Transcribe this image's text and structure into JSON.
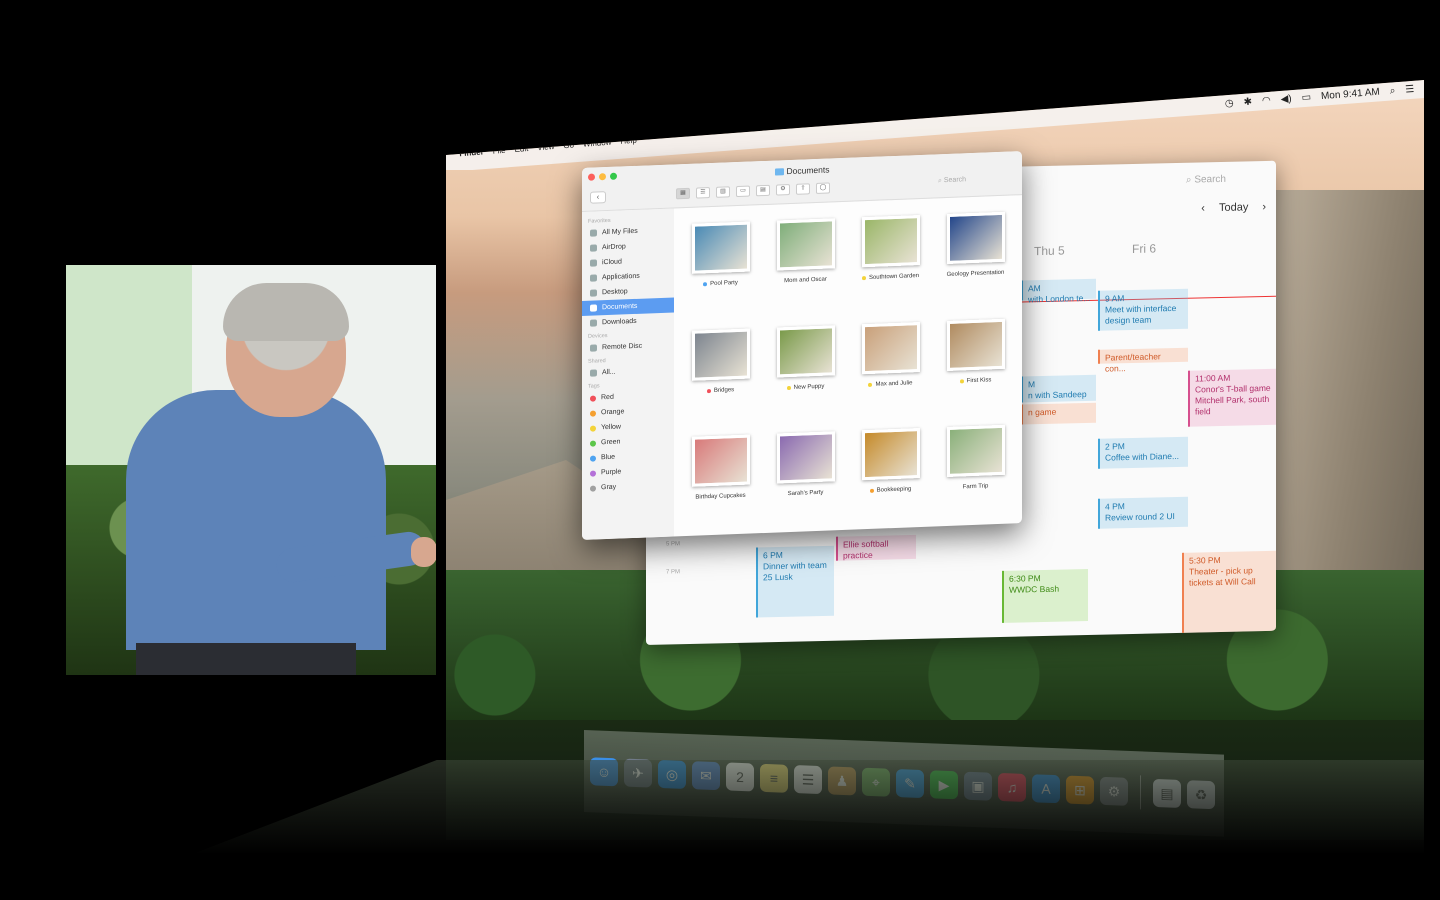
{
  "menubar": {
    "apple": "",
    "app_name": "Finder",
    "menus": [
      "File",
      "Edit",
      "View",
      "Go",
      "Window",
      "Help"
    ],
    "clock": "Mon 9:41 AM"
  },
  "calendar": {
    "search_placeholder": "Search",
    "today_label": "Today",
    "days": [
      "Thu 5",
      "Fri 6"
    ],
    "times": [
      "5 PM",
      "7 PM"
    ],
    "events": [
      {
        "text": "AM\nwith London te...",
        "color": "blue"
      },
      {
        "text": "9 AM\nMeet with interface design team",
        "color": "blue"
      },
      {
        "text": "Parent/teacher con...",
        "color": "orange"
      },
      {
        "text": "11:00 AM\nConor's T-ball game Mitchell Park, south field",
        "color": "pink"
      },
      {
        "text": "M\nn with Sandeep",
        "color": "blue"
      },
      {
        "text": "n game",
        "color": "orange"
      },
      {
        "text": "2 PM\nCoffee with Diane...",
        "color": "blue"
      },
      {
        "text": "4 PM\nReview round 2 UI",
        "color": "blue"
      },
      {
        "text": "Ellie softball practice",
        "color": "pink"
      },
      {
        "text": "6 PM\nDinner with team 25 Lusk",
        "color": "blue"
      },
      {
        "text": "6:30 PM\nWWDC Bash",
        "color": "green"
      },
      {
        "text": "5:30 PM\nTheater - pick up tickets at Will Call",
        "color": "orange"
      }
    ]
  },
  "finder": {
    "title": "Documents",
    "search_placeholder": "Search",
    "sidebar": {
      "favorites_header": "Favorites",
      "favorites": [
        "All My Files",
        "AirDrop",
        "iCloud",
        "Applications",
        "Desktop",
        "Documents",
        "Downloads"
      ],
      "selected": "Documents",
      "devices_header": "Devices",
      "devices": [
        "Remote Disc"
      ],
      "shared_header": "Shared",
      "shared": [
        "All..."
      ],
      "tags_header": "Tags",
      "tags": [
        {
          "name": "Red",
          "color": "#f0505a"
        },
        {
          "name": "Orange",
          "color": "#f5a030"
        },
        {
          "name": "Yellow",
          "color": "#f3d33a"
        },
        {
          "name": "Green",
          "color": "#5cc64a"
        },
        {
          "name": "Blue",
          "color": "#4ea3f0"
        },
        {
          "name": "Purple",
          "color": "#b471d8"
        },
        {
          "name": "Gray",
          "color": "#a0a0a0"
        }
      ]
    },
    "files": [
      {
        "name": "Pool Party",
        "tag": "#4ea3f0",
        "swatch": "#4a8ab5"
      },
      {
        "name": "Mom and Oscar",
        "tag": "",
        "swatch": "#7fae7a"
      },
      {
        "name": "Southtown Garden",
        "tag": "#f3d33a",
        "swatch": "#9ab668"
      },
      {
        "name": "Geology Presentation",
        "tag": "",
        "swatch": "#23468a"
      },
      {
        "name": "Bridges",
        "tag": "#f0505a",
        "swatch": "#7d858f"
      },
      {
        "name": "New Puppy",
        "tag": "#f3d33a",
        "swatch": "#7a9a4a"
      },
      {
        "name": "Max and Julie",
        "tag": "#f3d33a",
        "swatch": "#c9a07a"
      },
      {
        "name": "First Kiss",
        "tag": "#f3d33a",
        "swatch": "#b08b60"
      },
      {
        "name": "Birthday Cupcakes",
        "tag": "",
        "swatch": "#d87a7a"
      },
      {
        "name": "Sarah's Party",
        "tag": "",
        "swatch": "#8a6ab0"
      },
      {
        "name": "Bookkeeping",
        "tag": "#f5a030",
        "swatch": "#c58a2a"
      },
      {
        "name": "Farm Trip",
        "tag": "",
        "swatch": "#8ab07a"
      }
    ]
  },
  "dock": {
    "apps": [
      {
        "name": "finder-icon",
        "glyph": "☺",
        "color": "#3a8ee6"
      },
      {
        "name": "launchpad-icon",
        "glyph": "✈",
        "color": "#707a88"
      },
      {
        "name": "safari-icon",
        "glyph": "◎",
        "color": "#2b8fe8"
      },
      {
        "name": "mail-icon",
        "glyph": "✉",
        "color": "#5a8ad8"
      },
      {
        "name": "calendar-icon",
        "glyph": "2",
        "color": "#f4f4f4"
      },
      {
        "name": "notes-icon",
        "glyph": "≡",
        "color": "#f6e27a"
      },
      {
        "name": "reminders-icon",
        "glyph": "☰",
        "color": "#f2f2f2"
      },
      {
        "name": "contacts-icon",
        "glyph": "♟",
        "color": "#c49a5a"
      },
      {
        "name": "maps-icon",
        "glyph": "⌖",
        "color": "#7ab86a"
      },
      {
        "name": "messages-icon",
        "glyph": "✎",
        "color": "#3aa3f2"
      },
      {
        "name": "facetime-icon",
        "glyph": "▶",
        "color": "#3cc84a"
      },
      {
        "name": "iphoto-icon",
        "glyph": "▣",
        "color": "#6e7f98"
      },
      {
        "name": "itunes-icon",
        "glyph": "♫",
        "color": "#f03a5a"
      },
      {
        "name": "app-store-icon",
        "glyph": "A",
        "color": "#2d8fe8"
      },
      {
        "name": "ibooks-icon",
        "glyph": "⊞",
        "color": "#f39a1a"
      },
      {
        "name": "system-preferences-icon",
        "glyph": "⚙",
        "color": "#8a8f96"
      },
      {
        "name": "document-icon",
        "glyph": "▤",
        "color": "#e9eef2"
      },
      {
        "name": "trash-icon",
        "glyph": "♻",
        "color": "#cfd4d8"
      }
    ]
  }
}
